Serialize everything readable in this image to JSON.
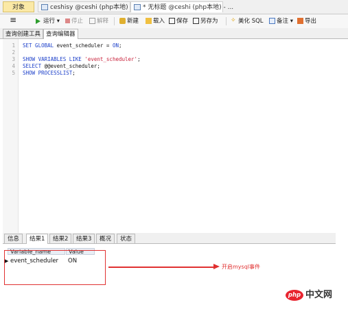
{
  "tabs": [
    {
      "label": "对象"
    },
    {
      "label": "ceshisy @ceshi (php本地) - 表"
    },
    {
      "label": "* 无标题 @ceshi (php本地) - ..."
    }
  ],
  "toolbar": {
    "menu_glyph": "≡",
    "run": "运行 ▾",
    "stop": "停止",
    "explain": "解释",
    "new": "新建",
    "load": "载入",
    "save": "保存",
    "save_as": "另存为",
    "beautify": "美化 SQL",
    "comment": "备注 ▾",
    "export": "导出"
  },
  "editor_tabs": [
    "查询创建工具",
    "查询编辑器"
  ],
  "editor": {
    "line_numbers": [
      "1",
      "2",
      "3",
      "4",
      "5"
    ],
    "lines": [
      [
        {
          "t": "SET GLOBAL ",
          "c": "kw"
        },
        {
          "t": "event_scheduler = ",
          "c": ""
        },
        {
          "t": "ON",
          "c": "kw"
        },
        {
          "t": ";",
          "c": ""
        }
      ],
      [],
      [
        {
          "t": "SHOW VARIABLES LIKE ",
          "c": "kw"
        },
        {
          "t": "'event_scheduler'",
          "c": "str"
        },
        {
          "t": ";",
          "c": ""
        }
      ],
      [
        {
          "t": "SELECT ",
          "c": "kw"
        },
        {
          "t": "@@event_scheduler;",
          "c": ""
        }
      ],
      [
        {
          "t": "SHOW PROCESSLIST",
          "c": "kw"
        },
        {
          "t": ";",
          "c": ""
        }
      ]
    ]
  },
  "result_tabs": [
    "信息",
    "结果1",
    "结果2",
    "结果3",
    "概况",
    "状态"
  ],
  "result_grid": {
    "columns": [
      "Variable_name",
      "Value"
    ],
    "rows": [
      [
        "event_scheduler",
        "ON"
      ]
    ],
    "row_marker": "▶"
  },
  "annotation": "开启mysql事件",
  "watermark": {
    "logo": "php",
    "text": "中文网"
  },
  "colors": {
    "annotation": "#e03030",
    "keyword": "#1a3ec9",
    "string": "#c8203a",
    "active_tab": "#fbe9a6"
  }
}
